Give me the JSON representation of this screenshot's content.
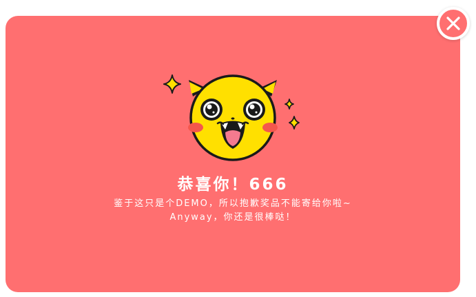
{
  "colors": {
    "modal_background": "#ff6f70",
    "close_button_background": "#ff6f70",
    "text": "#ffffff",
    "mascot_face": "#ffe000",
    "mascot_outline": "#1a1a1a",
    "mascot_cheek": "#f4574c",
    "sparkle": "#ffe000"
  },
  "close_button": {
    "icon": "close-icon"
  },
  "mascot": {
    "icon": "pikachu-face-icon"
  },
  "title": "恭喜你！666",
  "message": {
    "line1": "鉴于这只是个DEMO，所以抱歉奖品不能寄给你啦~",
    "line2": "Anyway，你还是很棒哒！"
  }
}
